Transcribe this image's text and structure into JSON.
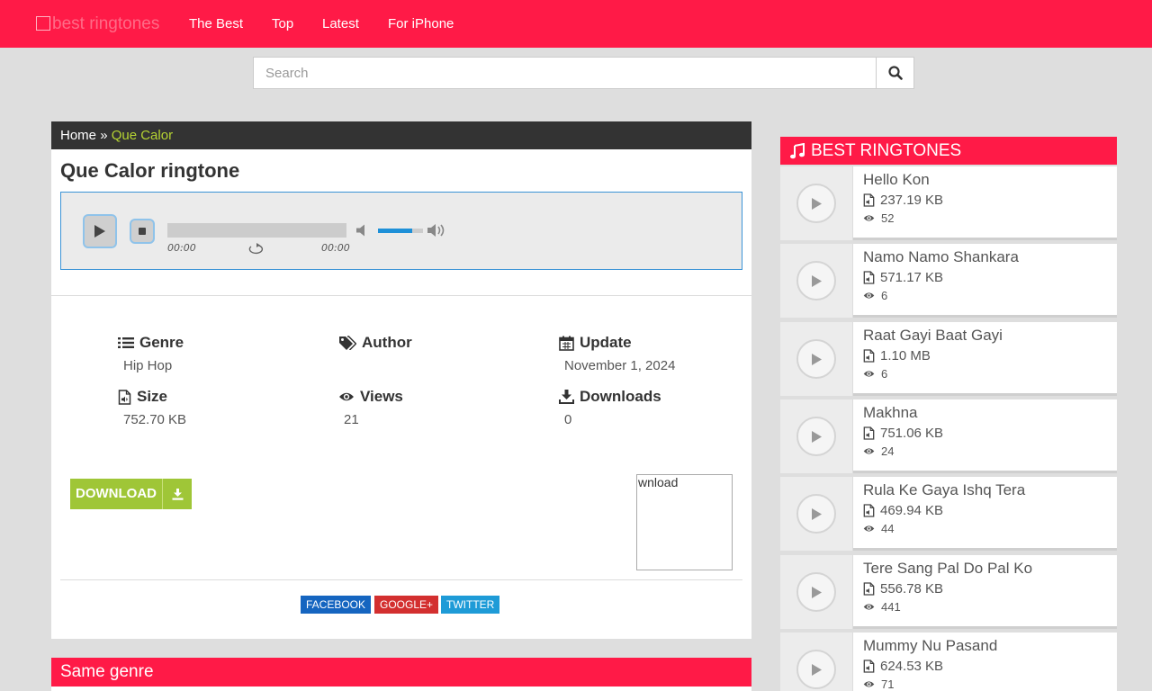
{
  "header": {
    "logo_alt": "best ringtones",
    "nav": [
      "The Best",
      "Top",
      "Latest",
      "For iPhone"
    ]
  },
  "search": {
    "placeholder": "Search"
  },
  "breadcrumb": {
    "home": "Home",
    "sep": "»",
    "current": "Que Calor"
  },
  "page_title": "Que Calor ringtone",
  "player": {
    "current_time": "00:00",
    "duration": "00:00",
    "volume_level": 0.76
  },
  "details": {
    "genre": {
      "label": "Genre",
      "value": "Hip Hop"
    },
    "author": {
      "label": "Author",
      "value": ""
    },
    "update": {
      "label": "Update",
      "value": "November 1, 2024"
    },
    "size": {
      "label": "Size",
      "value": "752.70 KB"
    },
    "views": {
      "label": "Views",
      "value": "21"
    },
    "downloads": {
      "label": "Downloads",
      "value": "0"
    }
  },
  "download_button": "DOWNLOAD",
  "ad_box_text": "wnload",
  "share": {
    "facebook": "FACEBOOK",
    "google": "GOOGLE+",
    "twitter": "TWITTER"
  },
  "same_genre_title": "Same genre",
  "sidebar": {
    "title": "BEST RINGTONES",
    "items": [
      {
        "name": "Hello Kon",
        "size": "237.19 KB",
        "views": "52"
      },
      {
        "name": "Namo Namo Shankara",
        "size": "571.17 KB",
        "views": "6"
      },
      {
        "name": "Raat Gayi Baat Gayi",
        "size": "1.10 MB",
        "views": "6"
      },
      {
        "name": "Makhna",
        "size": "751.06 KB",
        "views": "24"
      },
      {
        "name": "Rula Ke Gaya Ishq Tera",
        "size": "469.94 KB",
        "views": "44"
      },
      {
        "name": "Tere Sang Pal Do Pal Ko",
        "size": "556.78 KB",
        "views": "441"
      },
      {
        "name": "Mummy Nu Pasand",
        "size": "624.53 KB",
        "views": "71"
      }
    ]
  },
  "colors": {
    "brand": "#ff1a47",
    "accent_green": "#9fc637",
    "link_green": "#b5d333",
    "facebook": "#1565c0",
    "google": "#d32f2f",
    "twitter": "#1e9bd7"
  }
}
